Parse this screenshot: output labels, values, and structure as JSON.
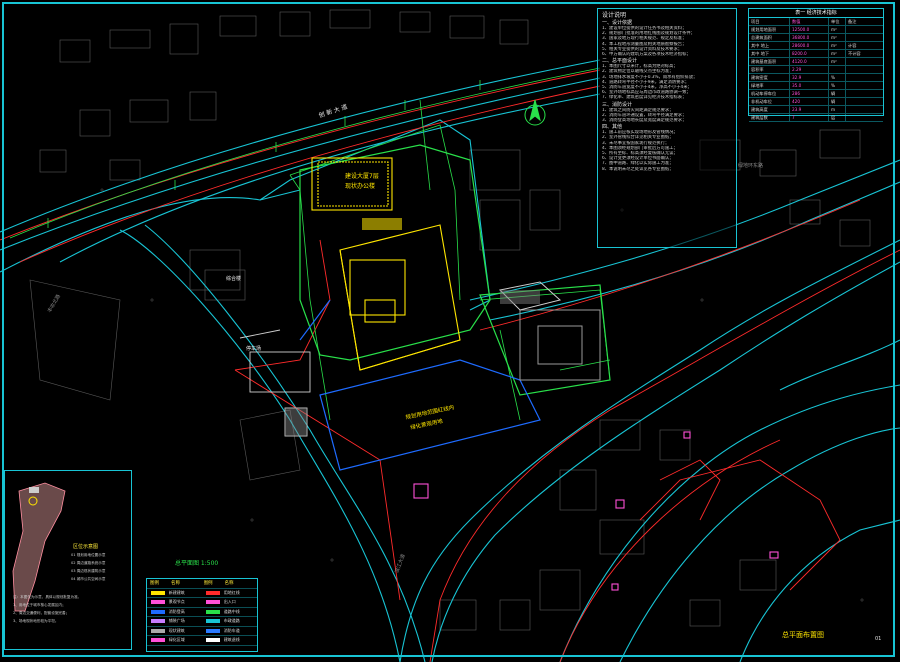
{
  "drawing": {
    "sheet_title": "总平面布置图",
    "sheet_number": "01",
    "scale_label": "总平面图 1:500"
  },
  "labels": {
    "road_north": "创 新 大 道",
    "road_east_gray": "绿地环东路",
    "building_main_a": "建设大厦7层",
    "building_main_b": "现状办公楼",
    "site_south_a": "规划用地范围红线内",
    "site_south_b": "绿化景观用地",
    "road_west": "丰收北路",
    "road_southwest": "滨江大道",
    "left_building": "综合楼",
    "left_parking": "停车场"
  },
  "notes_panel": {
    "title": "设计说明",
    "sections": [
      {
        "heading": "一、设计依据",
        "lines": [
          "1、建设单位提供的设计任务书及相关资料；",
          "2、规划部门批准的用地红线图及规划设计条件；",
          "3、国家及地方现行相关规范、规定及标准；",
          "4、本工程地形测量图及相关地质勘察报告；",
          "5、相关专业提供的设计资料及技术要求；",
          "6、甲方确认的建筑方案及各项技术经济指标；"
        ]
      },
      {
        "heading": "二、总平面设计",
        "lines": [
          "1、本图尺寸以米计，标高为绝对标高；",
          "2、建筑物定位以轴线交点坐标为准；",
          "3、场地排水坡度不小于0.3%，雨水有组织排放；",
          "4、道路转弯半径不小于9米，满足消防要求；",
          "5、消防车道宽度不小于4米，净高不小于4米；",
          "6、室外场地标高应与周边市政道路协调一致；",
          "7、绿化率、建筑密度详见经济技术指标表；"
        ]
      },
      {
        "heading": "三、消防设计",
        "lines": [
          "1、建筑之间防火间距满足规范要求；",
          "2、消防车道环通设置，转弯半径满足要求；",
          "3、消防登高场地长度及宽度满足规范要求；"
        ]
      },
      {
        "heading": "四、其他",
        "lines": [
          "1、施工前应核实现场地形及管线情况；",
          "2、室外管线综合详见相关专业图纸；",
          "3、未尽事宜按国家现行规范执行；",
          "4、本图须经规划部门审批后方可施工；",
          "5、所有坐标、标高须经复核确认无误；",
          "6、设计变更须经设计单位书面确认；",
          "7、图中道路、绿化以实际施工为准；",
          "8、本说明未尽之处详见各专业图纸；"
        ]
      }
    ]
  },
  "econ_table": {
    "title": "表一 经济技术指标",
    "rows": [
      [
        "项目",
        "数值",
        "单位",
        "备注"
      ],
      [
        "规划用地面积",
        "12500.0",
        "m²",
        ""
      ],
      [
        "总建筑面积",
        "36800.0",
        "m²",
        ""
      ],
      [
        "其中 地上",
        "28600.0",
        "m²",
        "计容"
      ],
      [
        "其中 地下",
        "8200.0",
        "m²",
        "不计容"
      ],
      [
        "建筑基底面积",
        "4120.0",
        "m²",
        ""
      ],
      [
        "容积率",
        "2.29",
        "",
        ""
      ],
      [
        "建筑密度",
        "32.9",
        "%",
        ""
      ],
      [
        "绿地率",
        "35.0",
        "%",
        ""
      ],
      [
        "机动车停车位",
        "286",
        "辆",
        ""
      ],
      [
        "非机动车位",
        "420",
        "辆",
        ""
      ],
      [
        "建筑高度",
        "23.9",
        "m",
        ""
      ],
      [
        "建筑层数",
        "7",
        "层",
        ""
      ]
    ]
  },
  "legend_panel": {
    "headers": [
      "图例",
      "名称",
      "图例",
      "名称"
    ],
    "rows": [
      {
        "c1": "#ffe600",
        "n1": "新建建筑",
        "c2": "#ff2b2b",
        "n2": "用地红线"
      },
      {
        "c1": "#ff4fd8",
        "n1": "景观节点",
        "c2": "#ff4fd8",
        "n2": "出入口"
      },
      {
        "c1": "#1e6bff",
        "n1": "消防登高",
        "c2": "#29e04a",
        "n2": "道路中线"
      },
      {
        "c1": "#c77dff",
        "n1": "铺装广场",
        "c2": "#18c4d4",
        "n2": "市政道路"
      },
      {
        "c1": "#aaaaaa",
        "n1": "现状建筑",
        "c2": "#2b7bff",
        "n2": "消防车道"
      },
      {
        "c1": "#ff4fd8",
        "n1": "绿化区域",
        "c2": "#ffffff",
        "n2": "建筑退线"
      }
    ]
  },
  "keymap_panel": {
    "title": "区位示意图",
    "items": [
      "01  规划用地位置示意",
      "02  周边道路系统示意",
      "03  周边现状建筑示意",
      "04  城市公共空间示意",
      "注：本图仅为示意，具体以规划批复为准。",
      "1、用地位于城市核心发展区内；",
      "2、周边交通便利，配套设施完善；",
      "3、场地现状地形较为平坦。"
    ]
  },
  "colors": {
    "background": "#000000",
    "frame": "#18c4d4",
    "red_line": "#ff2b2b",
    "green_line": "#29e04a",
    "new_building": "#ffe600",
    "magenta": "#ff4fd8",
    "blue": "#1e6bff",
    "gray": "#6a6a6a"
  }
}
